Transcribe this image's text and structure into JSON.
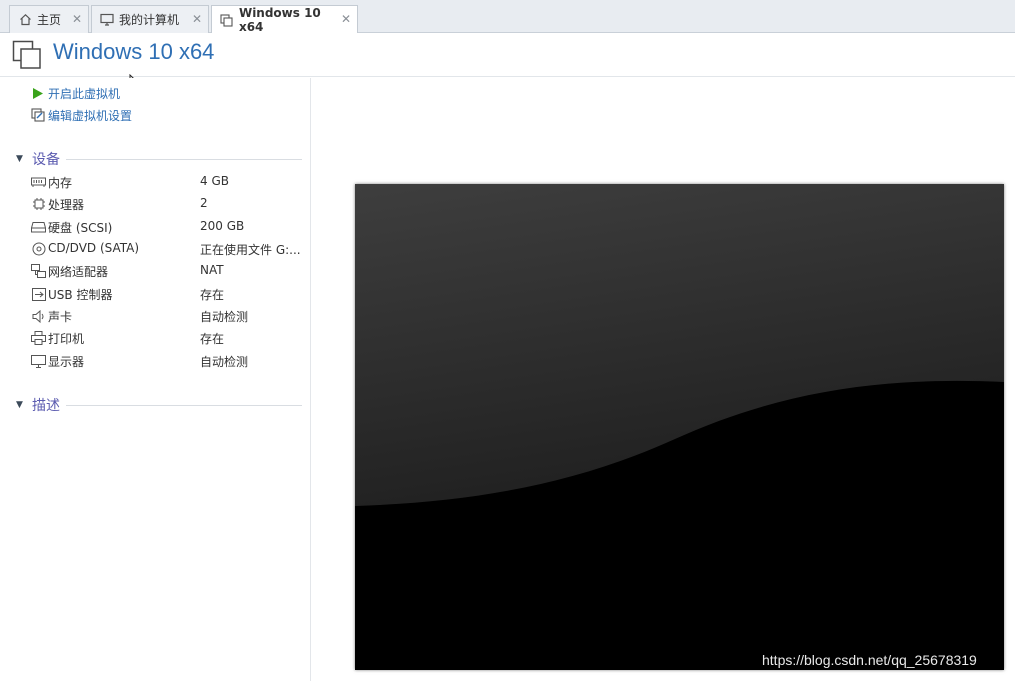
{
  "tabs": [
    {
      "label": "主页",
      "icon": "home-icon"
    },
    {
      "label": "我的计算机",
      "icon": "computer-icon"
    },
    {
      "label": "Windows 10 x64",
      "icon": "vm-icon",
      "active": true
    }
  ],
  "header": {
    "title": "Windows 10 x64"
  },
  "actions": [
    {
      "label": "开启此虚拟机",
      "icon": "play-icon"
    },
    {
      "label": "编辑虚拟机设置",
      "icon": "edit-settings-icon"
    }
  ],
  "devices_section": {
    "title": "设备"
  },
  "devices": [
    {
      "name": "内存",
      "value": "4 GB",
      "icon": "memory-icon"
    },
    {
      "name": "处理器",
      "value": "2",
      "icon": "processor-icon"
    },
    {
      "name": "硬盘 (SCSI)",
      "value": "200 GB",
      "icon": "hard-disk-icon"
    },
    {
      "name": "CD/DVD (SATA)",
      "value": "正在使用文件 G:...",
      "icon": "cd-dvd-icon"
    },
    {
      "name": "网络适配器",
      "value": "NAT",
      "icon": "network-adapter-icon"
    },
    {
      "name": "USB 控制器",
      "value": "存在",
      "icon": "usb-icon"
    },
    {
      "name": "声卡",
      "value": "自动检测",
      "icon": "sound-card-icon"
    },
    {
      "name": "打印机",
      "value": "存在",
      "icon": "printer-icon"
    },
    {
      "name": "显示器",
      "value": "自动检测",
      "icon": "display-icon"
    }
  ],
  "description_section": {
    "title": "描述"
  },
  "watermark": "https://blog.csdn.net/qq_25678319",
  "colors": {
    "accent": "#2f6fb4",
    "section_title": "#5c5cb0",
    "play_green": "#3aa31a"
  }
}
